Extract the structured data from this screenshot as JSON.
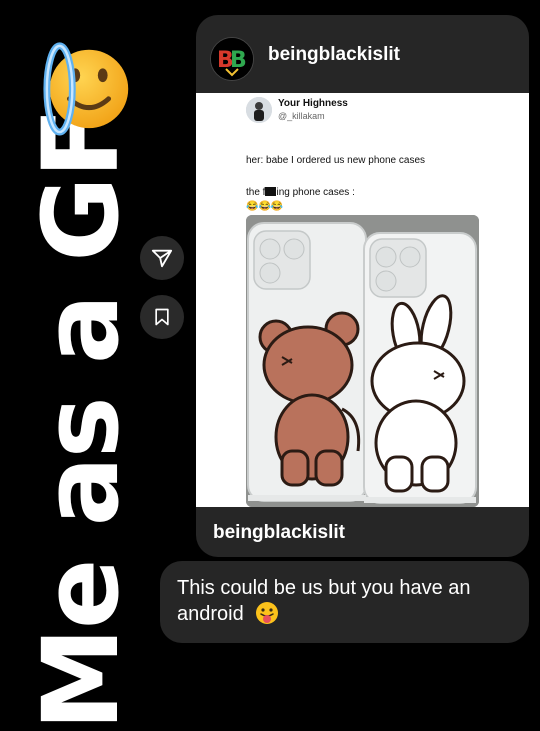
{
  "caption": {
    "text": "Me as a GF"
  },
  "icons": {
    "halo_emoji": "smiling-face-with-halo-icon",
    "share": "paper-plane-icon",
    "save": "bookmark-icon",
    "tongue_emoji": "face-with-tongue-icon"
  },
  "post": {
    "username": "beingblackislit",
    "footer_username": "beingblackislit",
    "tweet": {
      "name": "Your Highness",
      "handle": "@_killakam",
      "line1": "her: babe I ordered us new phone cases",
      "line2_before": "the f",
      "line2_after": "ing phone cases :",
      "emojis": "😂😂😂"
    }
  },
  "message": {
    "text": "This could be us but you have an android"
  },
  "colors": {
    "background": "#000000",
    "card": "#262626",
    "text": "#ffffff"
  }
}
